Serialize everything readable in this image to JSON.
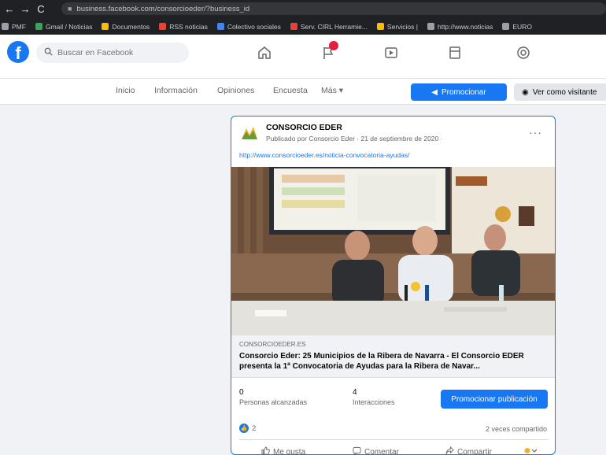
{
  "browser": {
    "back_glyph": "←",
    "forward_glyph": "→",
    "reload_glyph": "C",
    "url": "business.facebook.com/consorcioeder/?business_id",
    "bookmarks": [
      {
        "label": "PMF",
        "color": "#9aa0a6"
      },
      {
        "label": "Gmail / Noticias",
        "color": "#34a853"
      },
      {
        "label": "Documentos",
        "color": "#fbbc04"
      },
      {
        "label": "RSS noticias",
        "color": "#ea4335"
      },
      {
        "label": "Colectivo sociales",
        "color": "#4285f4"
      },
      {
        "label": "Serv. CIRL Herramie...",
        "color": "#e94235"
      },
      {
        "label": "Servicios |",
        "color": "#fbbc04"
      },
      {
        "label": "http://www.noticias",
        "color": "#9aa0a6"
      },
      {
        "label": "EURO",
        "color": "#9aa0a6"
      }
    ]
  },
  "fb_header": {
    "logo": "f",
    "search_placeholder": "Buscar en Facebook",
    "search_icon": "search-icon",
    "icons": [
      "home-icon",
      "flag-icon",
      "video-icon",
      "marketplace-icon",
      "groups-icon"
    ],
    "notification_color": "#e41e3f"
  },
  "page_tabs": {
    "tabs": [
      "Inicio",
      "Información",
      "Opiniones",
      "Encuesta",
      "Más ▾"
    ],
    "promote_label": "Promocionar",
    "visitor_label": "Ver como visitante"
  },
  "post": {
    "author": "CONSORCIO EDER",
    "meta": "Publicado por Consorcio Eder · 21 de septiembre de 2020 ·",
    "url": "http://www.consorcioeder.es/noticia-convocatoria-ayudas/",
    "more_glyph": "···",
    "link_domain": "consorcioeder.es",
    "link_title": "Consorcio Eder: 25 Municipios de la Ribera de Navarra - El Consorcio EDER presenta la 1ª Convocatoria de Ayudas para la Ribera de Navar...",
    "stats": [
      {
        "value": "0",
        "label": "Personas alcanzadas"
      },
      {
        "value": "4",
        "label": "Interacciones"
      }
    ],
    "promote_post_label": "Promocionar publicación",
    "reaction_count": "2",
    "share_count": "2 veces compartido",
    "actions": [
      {
        "icon": "👍",
        "label": "Me gusta"
      },
      {
        "icon": "💬",
        "label": "Comentar"
      },
      {
        "icon": "↪",
        "label": "Compartir"
      }
    ],
    "accent_color": "#1877f2"
  }
}
